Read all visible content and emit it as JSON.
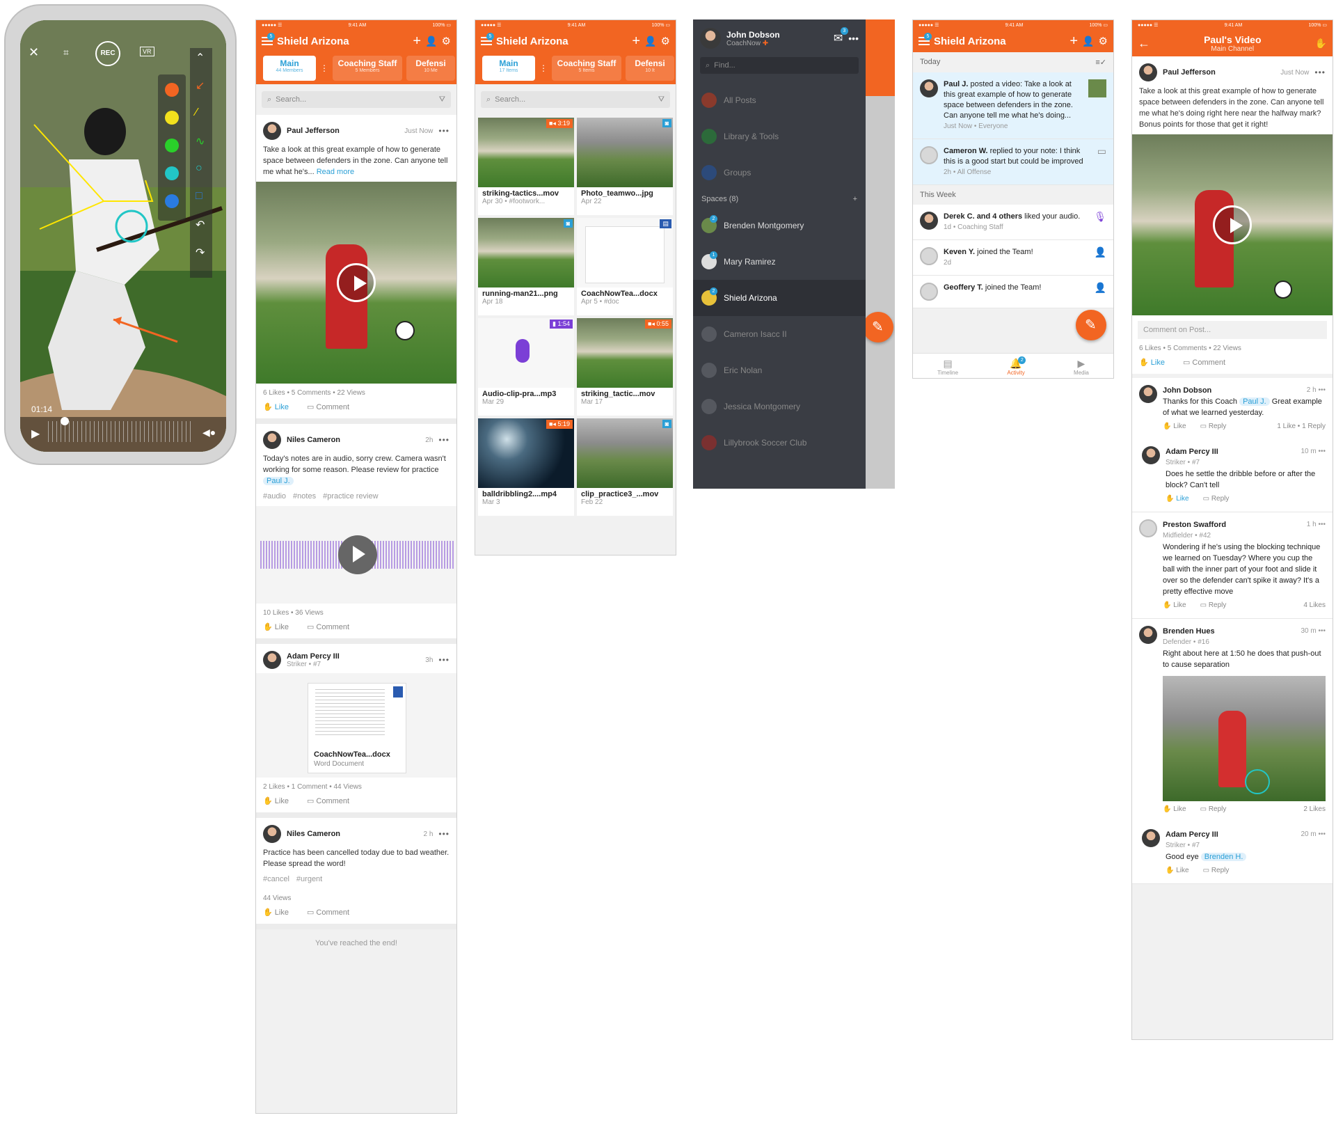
{
  "phone": {
    "record_label": "REC",
    "vr_label": "VR",
    "timecode": "01:14",
    "colors": [
      "#f26522",
      "#f2e11d",
      "#2ad02a",
      "#22c6c6",
      "#2a7be0"
    ]
  },
  "status": {
    "carrier": "●●●●● ☰",
    "time": "9:41 AM",
    "battery": "100% ▭"
  },
  "feed": {
    "title": "Shield Arizona",
    "notif_count": "5",
    "tabs": [
      {
        "label": "Main",
        "sub": "44 Members"
      },
      {
        "label": "Coaching Staff",
        "sub": "5 Members"
      },
      {
        "label": "Defensi",
        "sub": "10 Me"
      }
    ],
    "search_placeholder": "Search...",
    "posts": [
      {
        "name": "Paul Jefferson",
        "time": "Just Now",
        "text": "Take a look at this great example of how to generate space between defenders in the zone. Can anyone tell me what he's...",
        "readmore": "Read more",
        "stats": "6 Likes • 5 Comments • 22 Views",
        "like": "Like",
        "comment": "Comment"
      },
      {
        "name": "Niles Cameron",
        "time": "2h",
        "text": "Today's notes are in audio, sorry crew. Camera wasn't working for some reason. Please review for practice",
        "mention": "Paul J.",
        "tags": [
          "#audio",
          "#notes",
          "#practice review"
        ],
        "stats": "10 Likes • 36 Views",
        "like": "Like",
        "comment": "Comment"
      },
      {
        "name": "Adam Percy III",
        "sub": "Striker • #7",
        "time": "3h",
        "doc_name": "CoachNowTea...docx",
        "doc_type": "Word Document",
        "stats": "2 Likes • 1 Comment • 44 Views",
        "like": "Like",
        "comment": "Comment"
      },
      {
        "name": "Niles Cameron",
        "time": "2 h",
        "text": "Practice has been cancelled today due to bad weather. Please spread the word!",
        "tags": [
          "#cancel",
          "#urgent"
        ],
        "stats": "44 Views",
        "like": "Like",
        "comment": "Comment"
      }
    ],
    "end_text": "You've reached the end!"
  },
  "media": {
    "title": "Shield Arizona",
    "notif_count": "5",
    "tabs": [
      {
        "label": "Main",
        "sub": "17 Items"
      },
      {
        "label": "Coaching Staff",
        "sub": "5 Items"
      },
      {
        "label": "Defensi",
        "sub": "10 It"
      }
    ],
    "search_placeholder": "Search...",
    "items": [
      {
        "name": "striking-tactics...mov",
        "date": "Apr 30  •  #footwork...",
        "badge": "3:19"
      },
      {
        "name": "Photo_teamwo...jpg",
        "date": "Apr 22",
        "badge": ""
      },
      {
        "name": "running-man21...png",
        "date": "Apr 18",
        "badge": ""
      },
      {
        "name": "CoachNowTea...docx",
        "date": "Apr 5  •  #doc",
        "badge": ""
      },
      {
        "name": "Audio-clip-pra...mp3",
        "date": "Mar 29",
        "badge": "1:54"
      },
      {
        "name": "striking_tactic...mov",
        "date": "Mar 17",
        "badge": "0:55"
      },
      {
        "name": "balldribbling2....mp4",
        "date": "Mar 3",
        "badge": "5:19"
      },
      {
        "name": "clip_practice3_...mov",
        "date": "Feb 22",
        "badge": ""
      }
    ]
  },
  "drawer": {
    "user": "John Dobson",
    "sub": "CoachNow",
    "mail_count": "3",
    "find_placeholder": "Find...",
    "menu": [
      "All Posts",
      "Library & Tools",
      "Groups"
    ],
    "spaces_label": "Spaces (8)",
    "spaces": [
      {
        "name": "Brenden Montgomery",
        "badge": "2"
      },
      {
        "name": "Mary Ramirez",
        "badge": "1"
      },
      {
        "name": "Shield Arizona",
        "badge": "2"
      },
      {
        "name": "Cameron Isacc II",
        "badge": ""
      },
      {
        "name": "Eric Nolan",
        "badge": ""
      },
      {
        "name": "Jessica Montgomery",
        "badge": ""
      },
      {
        "name": "Lillybrook Soccer Club",
        "badge": ""
      }
    ]
  },
  "activity": {
    "title": "Shield Arizona",
    "notif_count": "5",
    "today_label": "Today",
    "week_label": "This Week",
    "items_today": [
      {
        "who": "Paul J.",
        "text": " posted a video: Take a look at this great example of how to generate space between defenders in the zone. Can anyone tell me what he's doing...",
        "meta": "Just Now • Everyone"
      },
      {
        "who": "Cameron W.",
        "text": " replied to your note: I think this is a good start but could be improved",
        "meta": "2h • All Offense"
      }
    ],
    "items_week": [
      {
        "who": "Derek C. and 4 others",
        "text": " liked your audio.",
        "meta": "1d • Coaching Staff"
      },
      {
        "who": "Keven Y.",
        "text": " joined the Team!",
        "meta": "2d"
      },
      {
        "who": "Geoffery T.",
        "text": " joined the Team!",
        "meta": ""
      }
    ],
    "nav": [
      "Timeline",
      "Activity",
      "Media"
    ],
    "activity_badge": "2"
  },
  "detail": {
    "title": "Paul's Video",
    "subtitle": "Main Channel",
    "author": "Paul Jefferson",
    "time": "Just Now",
    "text": "Take a look at this great example of how to generate space between defenders in the zone. Can anyone tell me what he's doing right here near the halfway mark? Bonus points for those that get it right!",
    "comment_placeholder": "Comment on Post...",
    "stats": "6 Likes • 5 Comments • 22 Views",
    "like": "Like",
    "comment": "Comment",
    "comments": [
      {
        "name": "John Dobson",
        "sub": "",
        "time": "2 h",
        "text": "Thanks for this Coach",
        "mention": "Paul J.",
        "text2": " Great example of what we learned yesterday.",
        "right": "1 Like • 1 Reply"
      },
      {
        "name": "Adam Percy III",
        "sub": "Striker • #7",
        "time": "10 m",
        "text": "Does he settle the dribble before or after the block? Can't tell",
        "mention": "",
        "text2": "",
        "right": ""
      },
      {
        "name": "Preston Swafford",
        "sub": "Midfielder • #42",
        "time": "1 h",
        "text": "Wondering if he's using the blocking technique we learned on Tuesday? Where you cup the ball with the inner part of your foot and slide it over so the defender can't spike it away? It's a pretty effective move",
        "mention": "",
        "text2": "",
        "right": "4 Likes"
      },
      {
        "name": "Brenden Hues",
        "sub": "Defender • #16",
        "time": "30 m",
        "text": "Right about here at 1:50 he does that push-out to cause separation",
        "mention": "",
        "text2": "",
        "right": "2 Likes"
      },
      {
        "name": "Adam Percy III",
        "sub": "Striker • #7",
        "time": "20 m",
        "text": "Good eye",
        "mention": "Brenden H.",
        "text2": "",
        "right": ""
      }
    ],
    "like_label": "Like",
    "reply_label": "Reply"
  }
}
